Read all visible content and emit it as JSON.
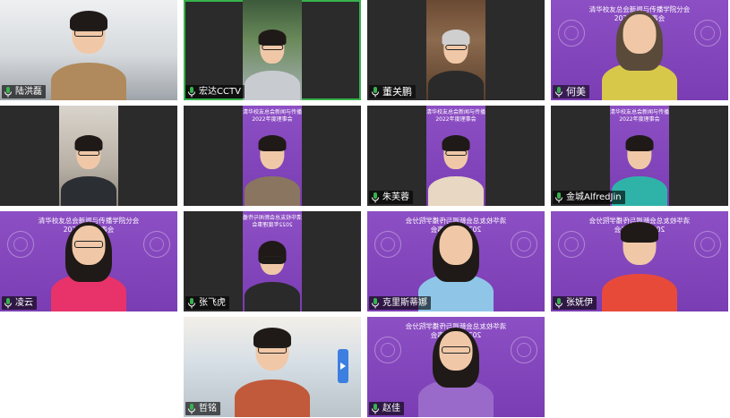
{
  "meeting": {
    "banner_line1": "清华校友总会新闻与传播学院分会",
    "banner_line2": "2022年度理事会"
  },
  "colors": {
    "banner_purple": "#8449bd",
    "active_speaker": "#37b24d",
    "label_bg": "#000000"
  },
  "participants": [
    {
      "name": "陆洪磊",
      "background": "room",
      "mic": "mic-icon"
    },
    {
      "name": "宏达CCTV",
      "background": "outdoor",
      "mic": "mic-icon"
    },
    {
      "name": "董关鹏",
      "background": "books",
      "mic": "mic-icon"
    },
    {
      "name": "何美",
      "background": "purple-banner",
      "mic": "mic-icon"
    },
    {
      "name": "",
      "background": "home",
      "mic": ""
    },
    {
      "name": "",
      "background": "purple-banner",
      "mic": ""
    },
    {
      "name": "朱芙蓉",
      "background": "purple-banner",
      "mic": "mic-icon"
    },
    {
      "name": "金城AlfredJin",
      "background": "purple-banner",
      "mic": "mic-icon"
    },
    {
      "name": "凌云",
      "background": "purple-banner",
      "mic": "mic-icon"
    },
    {
      "name": "张飞虎",
      "background": "purple-banner-mirrored",
      "mic": "mic-icon"
    },
    {
      "name": "克里斯蒂娜",
      "background": "purple-banner-mirrored",
      "mic": "mic-icon"
    },
    {
      "name": "张妩伊",
      "background": "purple-banner-mirrored",
      "mic": "mic-icon"
    },
    {
      "name": "哲铭",
      "background": "window",
      "mic": "mic-icon"
    },
    {
      "name": "赵佳",
      "background": "purple-banner-mirrored",
      "mic": "mic-icon"
    }
  ]
}
